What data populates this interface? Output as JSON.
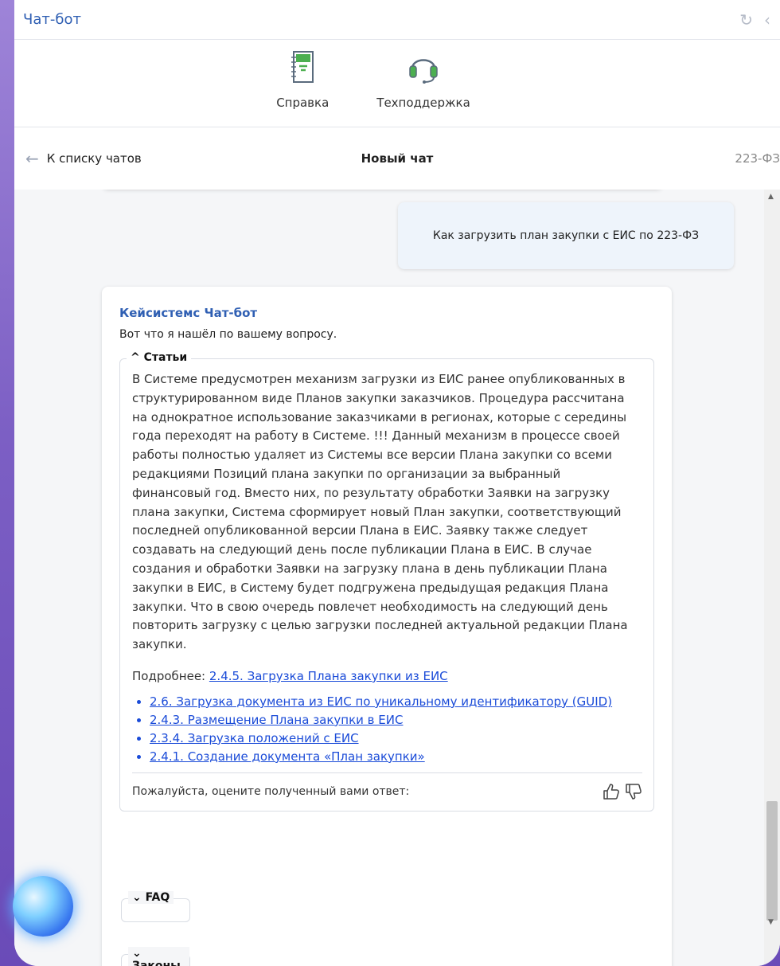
{
  "titlebar": {
    "title": "Чат-бот",
    "refresh_icon": "↻",
    "collapse_icon": "‹"
  },
  "toolbar": {
    "help_label": "Справка",
    "support_label": "Техподдержка"
  },
  "chat_header": {
    "back_label": "К списку чатов",
    "title": "Новый чат",
    "law": "223-ФЗ"
  },
  "user_message": "Как загрузить план закупки с ЕИС по 223-ФЗ",
  "bot_message": {
    "author": "Кейсистемс Чат-бот",
    "intro": "Вот что я нашёл по вашему вопросу.",
    "articles_legend": "^ Статьи",
    "article_text": "В Системе предусмотрен механизм загрузки из ЕИС ранее опубликованных в структурированном виде Планов закупки заказчиков. Процедура рассчитана на однократное использование заказчиками в регионах, которые с середины года переходят на работу в Системе. !!! Данный механизм в процессе своей работы полностью удаляет из Системы все версии Плана закупки со всеми редакциями Позиций плана закупки по организации за выбранный финансовый год. Вместо них, по результату обработки Заявки на загрузку плана закупки, Система сформирует новый План закупки, соответствующий последней опубликованной версии Плана в ЕИС. Заявку также следует создавать на следующий день после публикации Плана в ЕИС. В случае создания и обработки Заявки на загрузку плана в день публикации Плана закупки в ЕИС, в Систему будет подгружена предыдущая редакция Плана закупки. Что в свою очередь повлечет необходимость на следующий день повторить загрузку с целью загрузки последней актуальной редакции Плана закупки.",
    "more_label": "Подробнее:",
    "more_link": "2.4.5. Загрузка Плана закупки из ЕИС",
    "related_links": [
      "2.6. Загрузка документа из ЕИС по уникальному идентификатору (GUID)",
      "2.4.3. Размещение Плана закупки в ЕИС",
      "2.3.4. Загрузка положений с ЕИС",
      "2.4.1. Создание документа «План закупки»"
    ],
    "rate_prompt": "Пожалуйста, оцените полученный вами ответ:"
  },
  "sections": {
    "faq": "⌄ FAQ",
    "laws": "⌄ Законы"
  },
  "colors": {
    "accent": "#2f5fb3",
    "link": "#1a4bd8",
    "background": "#f5f6f8"
  }
}
